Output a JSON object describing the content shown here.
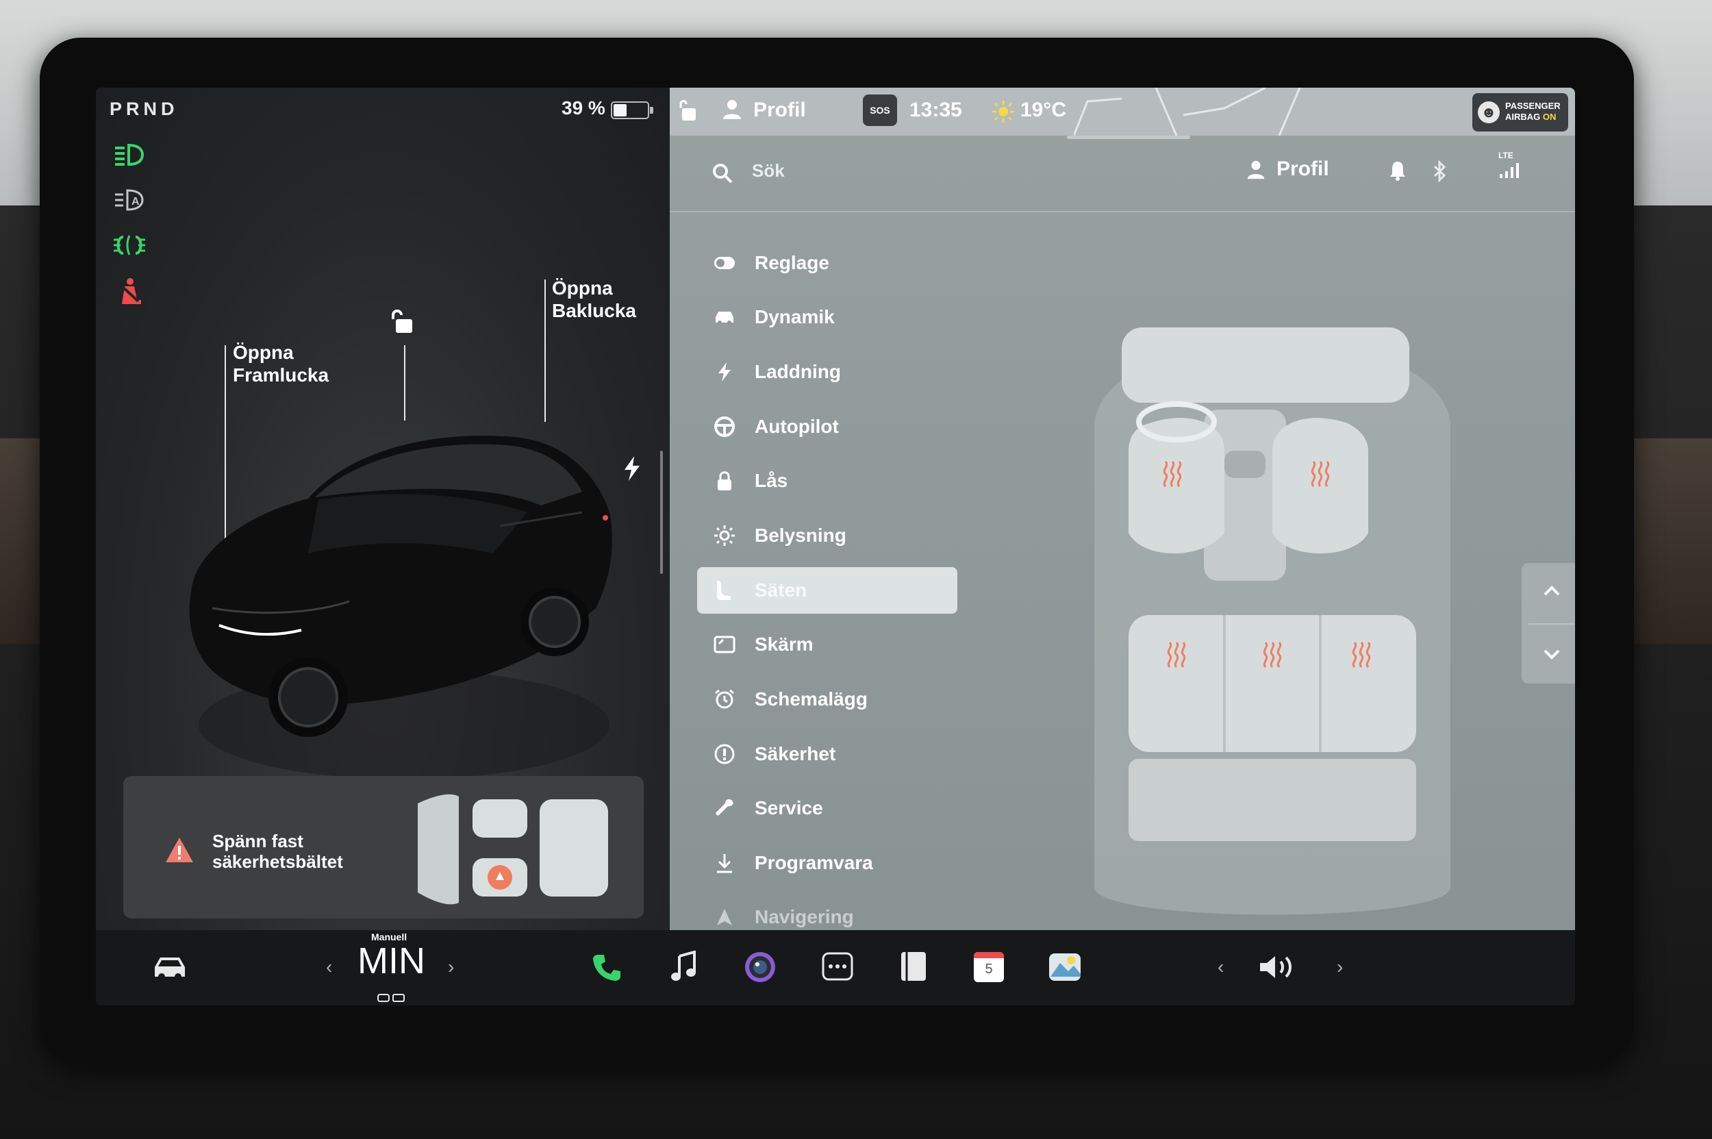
{
  "left_panel": {
    "gear": "PRND",
    "battery_pct": "39 %",
    "battery_level": 0.39,
    "callouts": {
      "frunk": [
        "Öppna",
        "Framlucka"
      ],
      "trunk": [
        "Öppna",
        "Baklucka"
      ]
    },
    "seatbelt_warning": [
      "Spänn fast",
      "säkerhetsbältet"
    ],
    "telltales": [
      "headlight-green",
      "auto-headlight",
      "fog-light-green",
      "seatbelt-warning-red"
    ]
  },
  "status_bar": {
    "profile": "Profil",
    "sos": "SOS",
    "time": "13:35",
    "temperature": "19°C",
    "airbag": [
      "PASSENGER",
      "AIRBAG",
      "ON"
    ]
  },
  "settings": {
    "search_placeholder": "Sök",
    "header_profile": "Profil",
    "lte": "LTE",
    "menu": [
      {
        "label": "Reglage",
        "icon": "toggle-icon"
      },
      {
        "label": "Dynamik",
        "icon": "car-icon"
      },
      {
        "label": "Laddning",
        "icon": "bolt-icon"
      },
      {
        "label": "Autopilot",
        "icon": "steering-wheel-icon"
      },
      {
        "label": "Lås",
        "icon": "lock-icon"
      },
      {
        "label": "Belysning",
        "icon": "sun-icon"
      },
      {
        "label": "Säten",
        "icon": "seat-icon"
      },
      {
        "label": "Skärm",
        "icon": "display-icon"
      },
      {
        "label": "Schemalägg",
        "icon": "alarm-clock-icon"
      },
      {
        "label": "Säkerhet",
        "icon": "info-circle-icon"
      },
      {
        "label": "Service",
        "icon": "wrench-icon"
      },
      {
        "label": "Programvara",
        "icon": "download-icon"
      },
      {
        "label": "Navigering",
        "icon": "navigation-icon"
      }
    ],
    "active_item": "Säten"
  },
  "dock": {
    "climate_mode": "Manuell",
    "temperature": "MIN",
    "calendar_day": "5"
  },
  "colors": {
    "accent_green": "#39d46b",
    "warning_red": "#ef4b4b",
    "heat_orange": "#f07d5e",
    "panel_gray": "#8f9899"
  }
}
